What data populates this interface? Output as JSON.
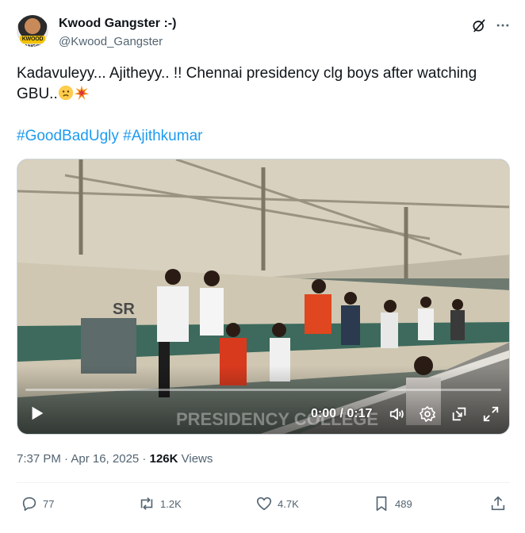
{
  "author": {
    "display_name": "Kwood Gangster :-)",
    "handle": "@Kwood_Gangster",
    "avatar_badge_text": "KWOOD GANGSTER"
  },
  "tweet": {
    "text": "Kadavuleyy...  Ajitheyy.. !! Chennai presidency clg boys after watching GBU..",
    "hashtags": [
      "#GoodBadUgly",
      "#Ajithkumar"
    ]
  },
  "video": {
    "time_display": "0:00 / 0:17",
    "progress": 0,
    "overlay_text": "PRESIDENCY COLLEGE",
    "train_text": "SR"
  },
  "meta": {
    "timestamp": "7:37 PM · Apr 16, 2025",
    "separator": " · ",
    "views_count": "126K",
    "views_label": "Views"
  },
  "actions": {
    "replies": "77",
    "reposts": "1.2K",
    "likes": "4.7K",
    "bookmarks": "489"
  },
  "colors": {
    "link": "#1d9bf0",
    "secondary_text": "#536471",
    "primary_text": "#0f1419"
  },
  "icons": [
    "grok-icon",
    "more-icon",
    "play-icon",
    "volume-icon",
    "settings-icon",
    "pip-icon",
    "fullscreen-icon",
    "reply-icon",
    "repost-icon",
    "like-icon",
    "bookmark-icon",
    "share-icon",
    "worried-emoji-icon",
    "collision-emoji-icon"
  ]
}
